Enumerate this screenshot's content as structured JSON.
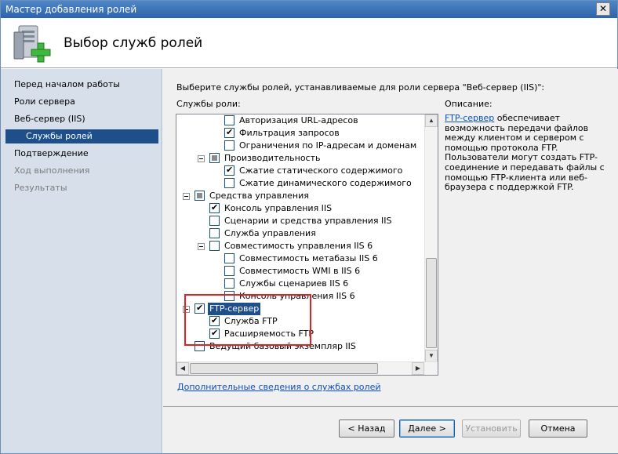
{
  "window": {
    "title": "Мастер добавления ролей",
    "close_symbol": "✕"
  },
  "header": {
    "title": "Выбор служб ролей",
    "icon": "server-add-icon"
  },
  "nav": {
    "items": [
      {
        "label": "Перед началом работы",
        "state": "normal"
      },
      {
        "label": "Роли сервера",
        "state": "normal"
      },
      {
        "label": "Веб-сервер (IIS)",
        "state": "normal"
      },
      {
        "label": "Службы ролей",
        "state": "active"
      },
      {
        "label": "Подтверждение",
        "state": "normal"
      },
      {
        "label": "Ход выполнения",
        "state": "disabled"
      },
      {
        "label": "Результаты",
        "state": "disabled"
      }
    ]
  },
  "content": {
    "instruction": "Выберите службы ролей, устанавливаемые для роли сервера \"Веб-сервер (IIS)\":",
    "services_label": "Службы роли:",
    "description_label": "Описание:",
    "description_link": "FTP-сервер",
    "description_text": " обеспечивает возможность передачи файлов между клиентом и сервером с помощью протокола FTP. Пользователи могут создать FTP-соединение и передавать файлы с помощью FTP-клиента или веб-браузера с поддержкой FTP.",
    "more_link": "Дополнительные сведения о службах ролей"
  },
  "tree": [
    {
      "label": "Авторизация URL-адресов",
      "level": 3,
      "state": "unchecked",
      "expander": false,
      "selected": false
    },
    {
      "label": "Фильтрация запросов",
      "level": 3,
      "state": "checked",
      "expander": false,
      "selected": false
    },
    {
      "label": "Ограничения по IP-адресам и доменам",
      "level": 3,
      "state": "unchecked",
      "expander": false,
      "selected": false
    },
    {
      "label": "Производительность",
      "level": 2,
      "state": "partial",
      "expander": true,
      "selected": false
    },
    {
      "label": "Сжатие статического содержимого",
      "level": 3,
      "state": "checked",
      "expander": false,
      "selected": false
    },
    {
      "label": "Сжатие динамического содержимого",
      "level": 3,
      "state": "unchecked",
      "expander": false,
      "selected": false
    },
    {
      "label": "Средства управления",
      "level": 1,
      "state": "partial",
      "expander": true,
      "selected": false
    },
    {
      "label": "Консоль управления IIS",
      "level": 2,
      "state": "checked",
      "expander": false,
      "selected": false
    },
    {
      "label": "Сценарии и средства управления IIS",
      "level": 2,
      "state": "unchecked",
      "expander": false,
      "selected": false
    },
    {
      "label": "Служба управления",
      "level": 2,
      "state": "unchecked",
      "expander": false,
      "selected": false
    },
    {
      "label": "Совместимость управления IIS 6",
      "level": 2,
      "state": "unchecked",
      "expander": true,
      "selected": false
    },
    {
      "label": "Совместимость метабазы IIS 6",
      "level": 3,
      "state": "unchecked",
      "expander": false,
      "selected": false
    },
    {
      "label": "Совместимость WMI в IIS 6",
      "level": 3,
      "state": "unchecked",
      "expander": false,
      "selected": false
    },
    {
      "label": "Службы сценариев IIS 6",
      "level": 3,
      "state": "unchecked",
      "expander": false,
      "selected": false
    },
    {
      "label": "Консоль управления IIS 6",
      "level": 3,
      "state": "unchecked",
      "expander": false,
      "selected": false
    },
    {
      "label": "FTP-сервер",
      "level": 1,
      "state": "checked",
      "expander": true,
      "selected": true
    },
    {
      "label": "Служба FTP",
      "level": 2,
      "state": "checked",
      "expander": false,
      "selected": false
    },
    {
      "label": "Расширяемость FTP",
      "level": 2,
      "state": "checked",
      "expander": false,
      "selected": false
    },
    {
      "label": "Ведущий базовый экземпляр IIS",
      "level": 1,
      "state": "unchecked",
      "expander": false,
      "selected": false
    }
  ],
  "buttons": {
    "back": "< Назад",
    "next": "Далее >",
    "install": "Установить",
    "cancel": "Отмена"
  },
  "colors": {
    "selection": "#1e4f8a",
    "link": "#0a4ec2",
    "highlight_box": "#e0231e",
    "nav_bg": "#d6dfea"
  }
}
